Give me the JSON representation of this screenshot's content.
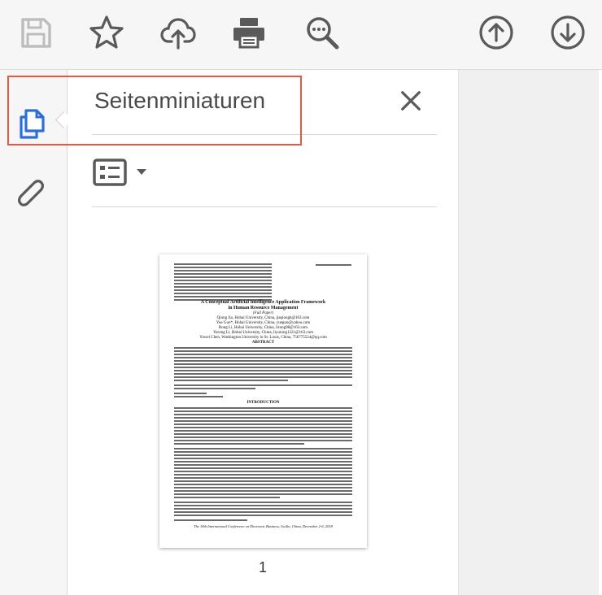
{
  "toolbar": {
    "buttons": [
      {
        "name": "save-icon",
        "state": "disabled"
      },
      {
        "name": "star-icon"
      },
      {
        "name": "cloud-upload-icon"
      },
      {
        "name": "printer-icon"
      },
      {
        "name": "zoom-out-icon"
      },
      {
        "name": "arrow-up-circle-icon"
      },
      {
        "name": "arrow-down-circle-icon"
      }
    ]
  },
  "rail": {
    "items": [
      {
        "name": "page-thumbnails-icon",
        "active": true
      },
      {
        "name": "attachments-icon",
        "active": false
      }
    ]
  },
  "panel": {
    "title": "Seitenminiaturen",
    "options_icon": "thumbnail-options-icon"
  },
  "thumbnail": {
    "page_number": "1",
    "header_left": "Jia Q., Guo Y., Li R., Li Y.R., & Chen Y.W. (2018). A conceptual artificial intelligence application framework in human resource management.",
    "header_right": "Jia, Guo, Li, Li & Chen",
    "title": "A Conceptual Artificial Intelligence Application Framework",
    "subtitle": "in Human Resource Management",
    "paper_type": "(Full Paper)",
    "authors": [
      "Qiong Jia, Hohai University, China, jiaqiongh@163.com",
      "Yue Guo*, Hohai University, China, yueguo@yahoo.com",
      "Rong Li, Hohai University, China, lirong98@163.com",
      "Yurong Li, Hohai University, China, liyurong1221@163.com",
      "Yuwei Chen, Washington University in St. Louis, China, 756775524@qq.com"
    ],
    "abstract_heading": "ABSTRACT",
    "intro_heading": "INTRODUCTION",
    "footer": "The 18th International Conference on Electronic Business, Guilin, China, December 2-6, 2018"
  },
  "colors": {
    "highlight": "#e05a44",
    "accent": "#2a6fdb",
    "icon": "#5a5a5a",
    "icon_disabled": "#bdbdbd"
  }
}
